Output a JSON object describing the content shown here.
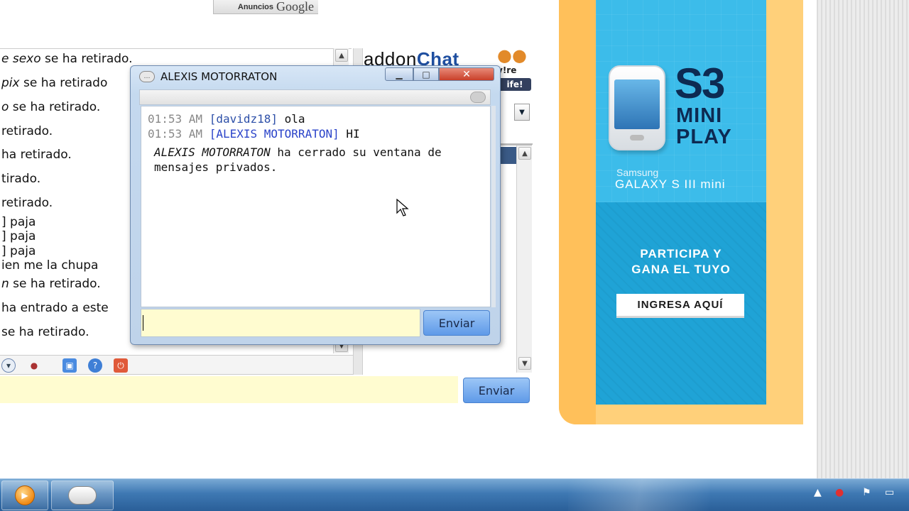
{
  "ads": {
    "label_small": "Anuncios",
    "label_brand": "Google"
  },
  "chat_log": {
    "lines": [
      {
        "pre_italic": "e sexo",
        "rest": " se ha retirado."
      },
      {
        "pre_italic": "pix",
        "rest": " se ha retirado"
      },
      {
        "pre_italic": "o",
        "rest": " se ha retirado."
      },
      {
        "pre_italic": "",
        "rest": " retirado."
      },
      {
        "pre_italic": "",
        "rest": " ha retirado."
      },
      {
        "pre_italic": "",
        "rest": "tirado."
      },
      {
        "pre_italic": "",
        "rest": " retirado."
      },
      {
        "pre_italic": "",
        "rest": "] paja"
      },
      {
        "pre_italic": "",
        "rest": "] paja"
      },
      {
        "pre_italic": "",
        "rest": "] paja"
      },
      {
        "pre_italic": "",
        "rest": "ien me la chupa"
      },
      {
        "pre_italic": "n",
        "rest": " se ha retirado."
      },
      {
        "pre_italic": "",
        "rest": "ha entrado a este"
      },
      {
        "pre_italic": "",
        "rest": "se ha retirado."
      }
    ]
  },
  "main_send_label": "Enviar",
  "sidebar": {
    "logo_addon": "addon",
    "logo_chat": "Chat",
    "badge_top": "v!re",
    "badge_bottom": "ife!"
  },
  "ad": {
    "s3": "S3",
    "mini_play": "MINI PLAY",
    "samsung": "Samsung",
    "galaxy": "GALAXY S III mini",
    "participa_line1": "PARTICIPA Y",
    "participa_line2": "GANA EL TUYO",
    "ingresa": "INGRESA AQUÍ",
    "colors": {
      "frame": "#ffc05a",
      "panel": "#2fb1e2",
      "text_dark": "#0d2a52"
    }
  },
  "pm": {
    "title": "ALEXIS MOTORRATON",
    "messages": [
      {
        "time": "01:53 AM",
        "nick": "[davidz18]",
        "text": " ola"
      },
      {
        "time": "01:53 AM",
        "nick": "[ALEXIS MOTORRATON]",
        "text": " HI"
      }
    ],
    "closed_name": "ALEXIS MOTORRATON",
    "closed_text": " ha cerrado su ventana de mensajes privados.",
    "send_label": "Enviar",
    "input_value": ""
  },
  "taskbar": {
    "items": [
      "media-player",
      "chat-app"
    ]
  }
}
